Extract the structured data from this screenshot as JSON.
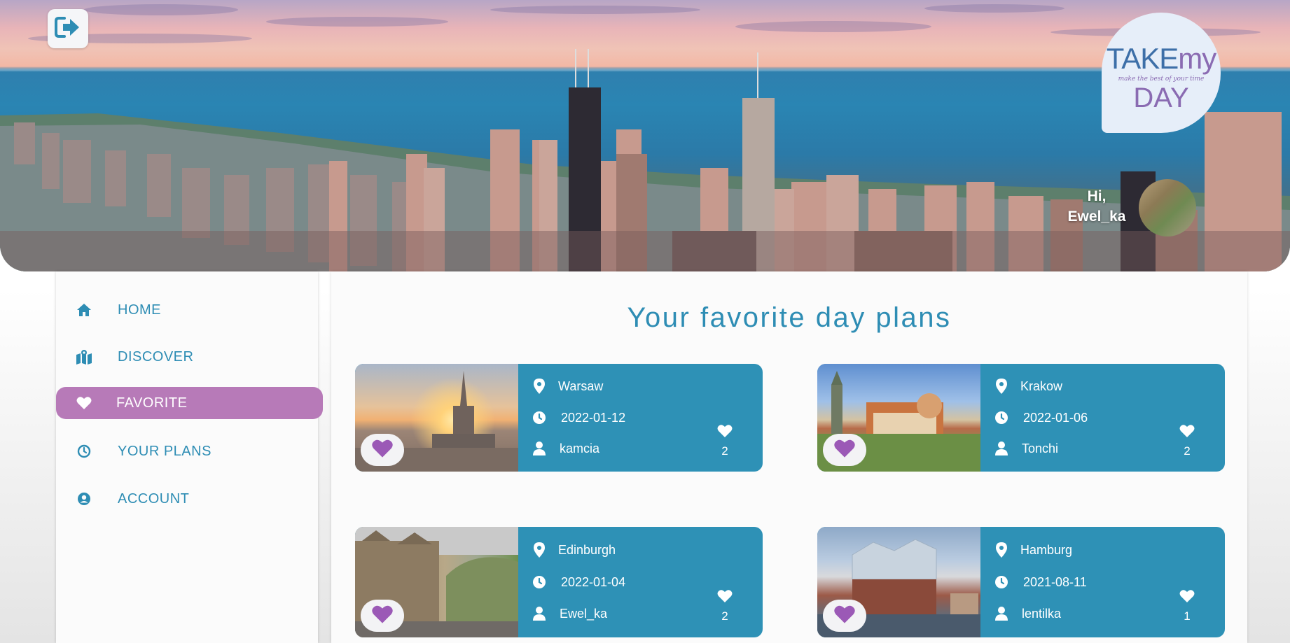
{
  "header": {
    "logout_icon": "sign-out-icon",
    "logo": {
      "line1": "TAKE",
      "line1b": "my",
      "tagline": "make the best of your time",
      "line2": "DAY"
    },
    "greeting": {
      "hi": "Hi,",
      "username": "Ewel_ka"
    }
  },
  "sidebar": {
    "items": [
      {
        "label": "HOME",
        "icon": "home-icon",
        "active": false
      },
      {
        "label": "DISCOVER",
        "icon": "map-icon",
        "active": false
      },
      {
        "label": "FAVORITE",
        "icon": "heart-icon",
        "active": true
      },
      {
        "label": "YOUR PLANS",
        "icon": "clock-icon",
        "active": false
      },
      {
        "label": "ACCOUNT",
        "icon": "user-circle-icon",
        "active": false
      }
    ]
  },
  "main": {
    "title": "Your favorite day plans",
    "plans": [
      {
        "city": "Warsaw",
        "date": "2022-01-12",
        "author": "kamcia",
        "likes": "2"
      },
      {
        "city": "Krakow",
        "date": "2022-01-06",
        "author": "Tonchi",
        "likes": "2"
      },
      {
        "city": "Edinburgh",
        "date": "2022-01-04",
        "author": "Ewel_ka",
        "likes": "2"
      },
      {
        "city": "Hamburg",
        "date": "2021-08-11",
        "author": "lentilka",
        "likes": "1"
      }
    ]
  },
  "colors": {
    "accent": "#2e8db4",
    "active_nav": "#b77ab8",
    "favorite_heart": "#9b59b6"
  }
}
